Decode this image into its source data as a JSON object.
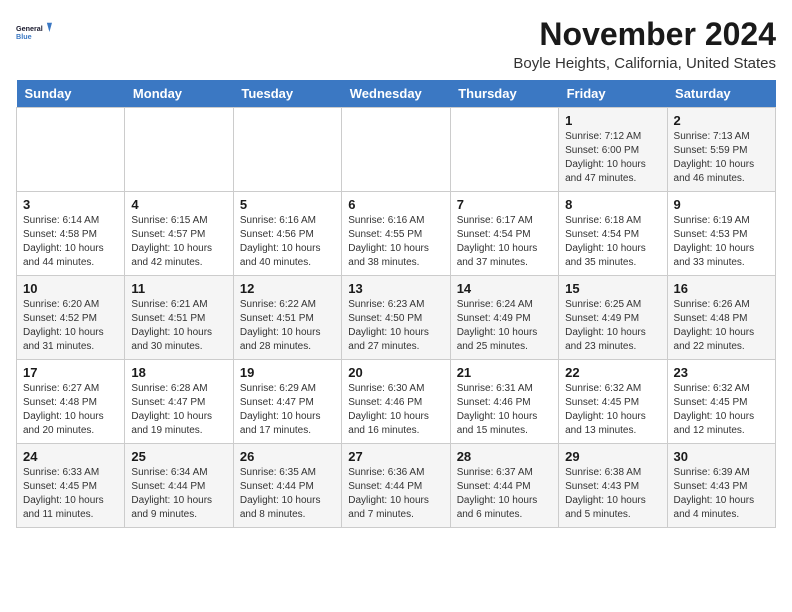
{
  "logo": {
    "line1": "General",
    "line2": "Blue"
  },
  "title": "November 2024",
  "location": "Boyle Heights, California, United States",
  "days_of_week": [
    "Sunday",
    "Monday",
    "Tuesday",
    "Wednesday",
    "Thursday",
    "Friday",
    "Saturday"
  ],
  "weeks": [
    [
      {
        "day": "",
        "info": ""
      },
      {
        "day": "",
        "info": ""
      },
      {
        "day": "",
        "info": ""
      },
      {
        "day": "",
        "info": ""
      },
      {
        "day": "",
        "info": ""
      },
      {
        "day": "1",
        "info": "Sunrise: 7:12 AM\nSunset: 6:00 PM\nDaylight: 10 hours and 47 minutes."
      },
      {
        "day": "2",
        "info": "Sunrise: 7:13 AM\nSunset: 5:59 PM\nDaylight: 10 hours and 46 minutes."
      }
    ],
    [
      {
        "day": "3",
        "info": "Sunrise: 6:14 AM\nSunset: 4:58 PM\nDaylight: 10 hours and 44 minutes."
      },
      {
        "day": "4",
        "info": "Sunrise: 6:15 AM\nSunset: 4:57 PM\nDaylight: 10 hours and 42 minutes."
      },
      {
        "day": "5",
        "info": "Sunrise: 6:16 AM\nSunset: 4:56 PM\nDaylight: 10 hours and 40 minutes."
      },
      {
        "day": "6",
        "info": "Sunrise: 6:16 AM\nSunset: 4:55 PM\nDaylight: 10 hours and 38 minutes."
      },
      {
        "day": "7",
        "info": "Sunrise: 6:17 AM\nSunset: 4:54 PM\nDaylight: 10 hours and 37 minutes."
      },
      {
        "day": "8",
        "info": "Sunrise: 6:18 AM\nSunset: 4:54 PM\nDaylight: 10 hours and 35 minutes."
      },
      {
        "day": "9",
        "info": "Sunrise: 6:19 AM\nSunset: 4:53 PM\nDaylight: 10 hours and 33 minutes."
      }
    ],
    [
      {
        "day": "10",
        "info": "Sunrise: 6:20 AM\nSunset: 4:52 PM\nDaylight: 10 hours and 31 minutes."
      },
      {
        "day": "11",
        "info": "Sunrise: 6:21 AM\nSunset: 4:51 PM\nDaylight: 10 hours and 30 minutes."
      },
      {
        "day": "12",
        "info": "Sunrise: 6:22 AM\nSunset: 4:51 PM\nDaylight: 10 hours and 28 minutes."
      },
      {
        "day": "13",
        "info": "Sunrise: 6:23 AM\nSunset: 4:50 PM\nDaylight: 10 hours and 27 minutes."
      },
      {
        "day": "14",
        "info": "Sunrise: 6:24 AM\nSunset: 4:49 PM\nDaylight: 10 hours and 25 minutes."
      },
      {
        "day": "15",
        "info": "Sunrise: 6:25 AM\nSunset: 4:49 PM\nDaylight: 10 hours and 23 minutes."
      },
      {
        "day": "16",
        "info": "Sunrise: 6:26 AM\nSunset: 4:48 PM\nDaylight: 10 hours and 22 minutes."
      }
    ],
    [
      {
        "day": "17",
        "info": "Sunrise: 6:27 AM\nSunset: 4:48 PM\nDaylight: 10 hours and 20 minutes."
      },
      {
        "day": "18",
        "info": "Sunrise: 6:28 AM\nSunset: 4:47 PM\nDaylight: 10 hours and 19 minutes."
      },
      {
        "day": "19",
        "info": "Sunrise: 6:29 AM\nSunset: 4:47 PM\nDaylight: 10 hours and 17 minutes."
      },
      {
        "day": "20",
        "info": "Sunrise: 6:30 AM\nSunset: 4:46 PM\nDaylight: 10 hours and 16 minutes."
      },
      {
        "day": "21",
        "info": "Sunrise: 6:31 AM\nSunset: 4:46 PM\nDaylight: 10 hours and 15 minutes."
      },
      {
        "day": "22",
        "info": "Sunrise: 6:32 AM\nSunset: 4:45 PM\nDaylight: 10 hours and 13 minutes."
      },
      {
        "day": "23",
        "info": "Sunrise: 6:32 AM\nSunset: 4:45 PM\nDaylight: 10 hours and 12 minutes."
      }
    ],
    [
      {
        "day": "24",
        "info": "Sunrise: 6:33 AM\nSunset: 4:45 PM\nDaylight: 10 hours and 11 minutes."
      },
      {
        "day": "25",
        "info": "Sunrise: 6:34 AM\nSunset: 4:44 PM\nDaylight: 10 hours and 9 minutes."
      },
      {
        "day": "26",
        "info": "Sunrise: 6:35 AM\nSunset: 4:44 PM\nDaylight: 10 hours and 8 minutes."
      },
      {
        "day": "27",
        "info": "Sunrise: 6:36 AM\nSunset: 4:44 PM\nDaylight: 10 hours and 7 minutes."
      },
      {
        "day": "28",
        "info": "Sunrise: 6:37 AM\nSunset: 4:44 PM\nDaylight: 10 hours and 6 minutes."
      },
      {
        "day": "29",
        "info": "Sunrise: 6:38 AM\nSunset: 4:43 PM\nDaylight: 10 hours and 5 minutes."
      },
      {
        "day": "30",
        "info": "Sunrise: 6:39 AM\nSunset: 4:43 PM\nDaylight: 10 hours and 4 minutes."
      }
    ]
  ],
  "colors": {
    "header_bg": "#3b78c3",
    "header_text": "#ffffff",
    "odd_row_bg": "#f5f5f5",
    "even_row_bg": "#ffffff"
  }
}
